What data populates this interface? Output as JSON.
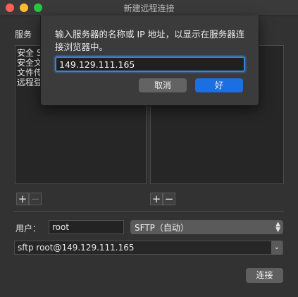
{
  "window": {
    "title": "新建远程连接"
  },
  "services": {
    "label": "服务",
    "items": [
      "安全 S",
      "安全文",
      "文件传",
      "远程登"
    ]
  },
  "buttons": {
    "add": "+",
    "remove": "−",
    "connect": "连接"
  },
  "user": {
    "label": "用户：",
    "value": "root"
  },
  "protocol": {
    "selected": "SFTP（自动）"
  },
  "command": {
    "value": "sftp root@149.129.111.165"
  },
  "sheet": {
    "message": "输入服务器的名称或 IP 地址，以显示在服务器连接浏览器中。",
    "input_value": "149.129.111.165",
    "cancel_label": "取消",
    "ok_label": "好"
  },
  "colors": {
    "accent": "#1c6fe0",
    "focus_ring": "#3a82d6",
    "close": "#ff5f57",
    "minimize": "#febc2e",
    "zoom": "#28c840"
  }
}
